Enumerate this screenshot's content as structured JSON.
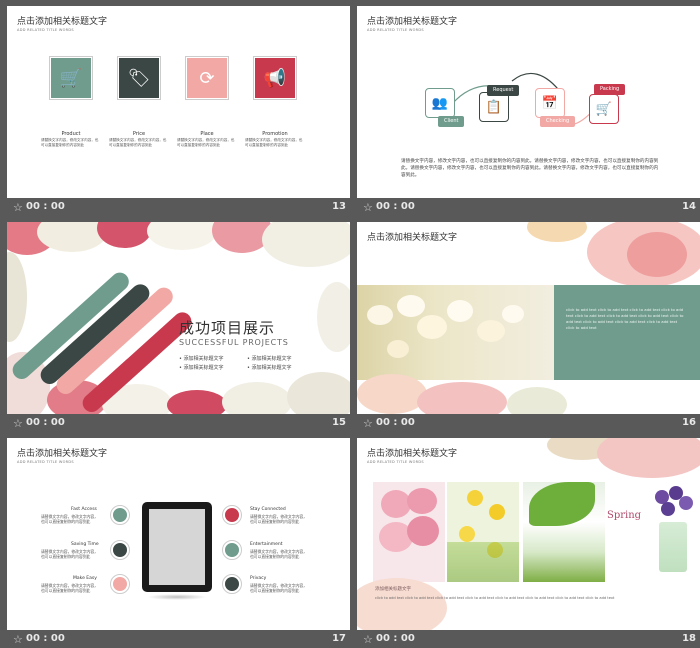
{
  "colors": {
    "green": "#6f9c8c",
    "dark": "#3b4744",
    "pink": "#f2a9a5",
    "red": "#c8394e",
    "bg": "#595959"
  },
  "slides": [
    {
      "time": "00 : 00",
      "num": "13",
      "title": "点击添加相关标题文字",
      "sub": "ADD RELATED TITLE WORDS",
      "items": [
        {
          "label": "Product",
          "icon": "cart-icon",
          "text": "请替换文字内容，修改文字内容，也可以直接复制你的内容到此"
        },
        {
          "label": "Price",
          "icon": "price-tag-icon",
          "text": "请替换文字内容，修改文字内容，也可以直接复制你的内容到此"
        },
        {
          "label": "Place",
          "icon": "refresh-icon",
          "text": "请替换文字内容，修改文字内容，也可以直接复制你的内容到此"
        },
        {
          "label": "Promotion",
          "icon": "megaphone-icon",
          "text": "请替换文字内容，修改文字内容，也可以直接复制你的内容到此"
        }
      ]
    },
    {
      "time": "00 : 00",
      "num": "14",
      "title": "点击添加相关标题文字",
      "sub": "ADD RELATED TITLE WORDS",
      "tags": [
        "Client",
        "Request",
        "Checking",
        "Packing"
      ],
      "paragraph": "请替换文字内容，修改文字内容，也可以直接复制你的内容到此。请替换文字内容，修改文字内容，也可以直接复制你的内容到此。请替换文字内容，修改文字内容，也可以直接复制你的内容到此。请替换文字内容，修改文字内容，也可以直接复制你的内容到此。"
    },
    {
      "time": "00 : 00",
      "num": "15",
      "heading": "成功项目展示",
      "heading_en": "SUCCESSFUL PROJECTS",
      "bullets": [
        "添加相关标题文字",
        "添加相关标题文字",
        "添加相关标题文字",
        "添加相关标题文字"
      ]
    },
    {
      "time": "00 : 00",
      "num": "16",
      "title": "点击添加相关标题文字",
      "box_text": "click to add text click to add text click to add text click to add text click to add text click to add text click to add text click to add text click to add text click to add text click to add text click to add text"
    },
    {
      "time": "00 : 00",
      "num": "17",
      "title": "点击添加相关标题文字",
      "sub": "ADD RELATED TITLE WORDS",
      "features": [
        {
          "title": "Fast Access",
          "text": "请替换文字内容，修改文字内容，也可以直接复制你的内容到此"
        },
        {
          "title": "Saving Time",
          "text": "请替换文字内容，修改文字内容，也可以直接复制你的内容到此"
        },
        {
          "title": "Make Easy",
          "text": "请替换文字内容，修改文字内容，也可以直接复制你的内容到此"
        },
        {
          "title": "Stay Connected",
          "text": "请替换文字内容，修改文字内容，也可以直接复制你的内容到此"
        },
        {
          "title": "Entertainment",
          "text": "请替换文字内容，修改文字内容，也可以直接复制你的内容到此"
        },
        {
          "title": "Privacy",
          "text": "请替换文字内容，修改文字内容，也可以直接复制你的内容到此"
        }
      ]
    },
    {
      "time": "00 : 00",
      "num": "18",
      "title": "点击添加相关标题文字",
      "sub": "ADD RELATED TITLE WORDS",
      "spring": "Spring",
      "caption": "添加相关标题文字",
      "footer": "click to add text click to add text click to add text click to add text click to add text click to add text click to add text click to add text"
    }
  ]
}
